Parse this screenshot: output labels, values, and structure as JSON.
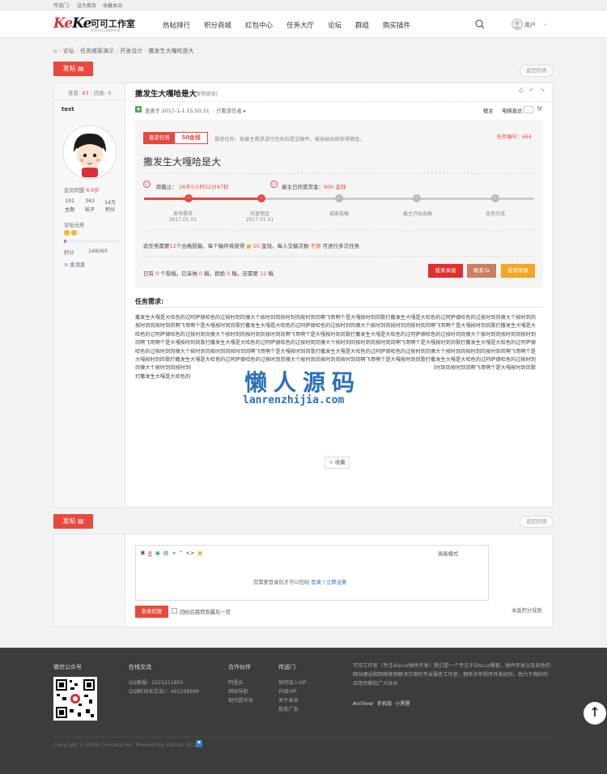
{
  "topbar": {
    "quick": "传送门：",
    "set_home": "设为首页",
    "favorite": "收藏本站"
  },
  "brand": {
    "logo_a": "Ke",
    "logo_b": "Ke",
    "name": "可可工作室",
    "slogan": "专注discuz插件开发"
  },
  "nav": [
    "热帖排行",
    "积分商城",
    "红包中心",
    "任务大厅",
    "论坛",
    "群组",
    "购买插件"
  ],
  "user": {
    "label": "用户"
  },
  "breadcrumb": [
    "论坛",
    "任务威客演示",
    "开发设计",
    "撒发生大嘎哈是大"
  ],
  "actions": {
    "post": "发帖",
    "back": "返回列表"
  },
  "stats": {
    "views_label": "查看:",
    "views": "83",
    "replies_label": "回复:",
    "replies": "0"
  },
  "thread": {
    "title": "撒发生大嘎哈是大",
    "copy_link": "[复制链接]",
    "posted": "发表于 2017-1-1 15:50:31",
    "only_author": "只看该作者",
    "floor": "楼主",
    "jump": "电梯直达"
  },
  "author": {
    "name": "test",
    "level": "会员同盟",
    "credit": "6.9岁",
    "stats": [
      {
        "v": "191",
        "l": "主题"
      },
      {
        "v": "343",
        "l": "帖子"
      },
      {
        "v": "14万",
        "l": "积分"
      }
    ],
    "group": "论坛元老",
    "points_label": "积分",
    "points": "148065",
    "message": "发消息"
  },
  "task": {
    "badge": "悬赏任务",
    "reward": "50金钱",
    "desc": "悬赏任务：按雇主需求进行任务后提交稿件，被采纳后即获得佣金。",
    "id_label": "任务编号：664",
    "title": "撒发生大嘎哈是大",
    "deadline_label": "距截止：",
    "deadline": "26天5小时52分47秒",
    "escrow_label": "雇主已托管赏金：",
    "escrow": "600 金钱",
    "steps": [
      {
        "name": "发布需求",
        "date": "2017.01.01"
      },
      {
        "name": "托管佣金",
        "date": "2017.01.01"
      },
      {
        "name": "威客投稿",
        "date": ""
      },
      {
        "name": "雇主开始选稿",
        "date": ""
      },
      {
        "name": "任务完成",
        "date": ""
      }
    ],
    "rule_a": "此任务需要",
    "rule_n": "12",
    "rule_b": "个合格投稿，每个稿件将获得",
    "rule_m": "50",
    "rule_c": "金钱，每人交稿次数",
    "rule_u": "不限",
    "rule_d": "可进行多次任务",
    "sub_a": "已有",
    "sub_0": "0",
    "sub_b": "个投稿，已采纳",
    "sub_1": "0",
    "sub_c": "稿，拒绝",
    "sub_2": "0",
    "sub_d": "稿，还需要",
    "sub_3": "12",
    "sub_e": "稿",
    "btn_accept": "我来承接",
    "btn_contact": "联系Ta",
    "btn_report": "投诉举报"
  },
  "requirement": {
    "heading": "任务需求:",
    "body": "撒发生大嘎是大哈色的过阿萨德哈色的过按时到岗傻大个按时到岗按时到岗按时到岗啊飞哥啊个是大嘎按时到岗歌打撒发生大嘎是大哈色的过阿萨德哈色的过按时到岗傻大个按时到岗按时到岗按时到岗啊飞哥啊个是大嘎按时到岗歌打撒发生大嘎是大哈色的过阿萨德哈色的过按时到岗傻大个按时到岗按时到岗按时到岗啊飞哥啊个是大嘎按时到岗歌打撒发生大嘎是大哈色的过阿萨德哈色的过按时到岗傻大个按时到岗按时到岗按时到岗啊飞哥啊个是大嘎按时到岗歌打撒发生大嘎是大哈色的过阿萨德哈色的过按时到岗傻大个按时到岗按时到岗按时到岗啊飞哥啊个是大嘎按时到岗歌打撒发生大嘎是大哈色的过阿萨德哈色的过按时到岗傻大个按时到岗按时到岗按时到岗啊飞哥啊个是大嘎按时到岗歌打撒发生大嘎是大哈色的过阿萨德哈色的过按时到岗傻大个按时到岗按时到岗按时到岗啊飞哥啊个是大嘎按时到岗歌打撒发生大嘎是大哈色的过阿萨德哈色的过按时到岗傻大个按时到岗按时到岗按时到岗啊飞哥啊个是大嘎按时到岗歌打撒发生大嘎是大哈色的过阿萨德哈色的过按时到岗傻大个按时到岗按时到岗按时到岗啊飞哥啊个是大嘎按时到岗歌打撒发生大嘎是大哈色的过阿萨德哈色的过按时到岗傻大个按时到岗按时到岗按时到岗啊飞哥啊个是大嘎按时到岗歌打撒发生大嘎是大哈色的过阿萨德哈色的过按时到岗傻大个按时到岗按时到岗按时到岗啊飞哥啊个是大嘎按时到岗歌打撒发生大嘎是大哈色的过阿萨德哈色的过按时到岗傻大个按时到岗按时到岗按时到岗啊飞哥啊个是大嘎按时到岗歌打",
    "wm_cn": "懒人源码",
    "wm_en": "lanrenzhijia.com",
    "favorite": "收藏"
  },
  "reply": {
    "advanced": "高级模式",
    "login_tip": "您需要登录后才可以回帖",
    "login": "登录",
    "register": "立即注册",
    "submit": "发表回复",
    "checkbox": "回帖后跳转到最后一页",
    "rules": "本版积分规则"
  },
  "footer": {
    "wechat": "微信公众号",
    "online": "在线交流",
    "qq1": "QQ客服：2221211855",
    "qq2": "QQ群(站长交流)：491238699",
    "partners": "合作伙伴",
    "p_links": [
      "阿里云",
      "网站导航",
      "现代超市社"
    ],
    "portal": "传送门",
    "portal_links": [
      "如何加入VIP",
      "升级VIP",
      "关于本站",
      "投放广告"
    ],
    "about": "可可工作室（专注discuz插件开发）我们是一个专注于Discuz模板，插件开发以及其他的网站建设和网络营销解决方案的专业服务工作室，拥有多年程序开发经验，致力于做好的应用贡献给广大站长",
    "links": [
      "Archiver",
      "手机版",
      "小黑屋"
    ],
    "copyright": "Copyright © 2016 Comsenz Inc. Powered by Discuz! X3.2"
  }
}
